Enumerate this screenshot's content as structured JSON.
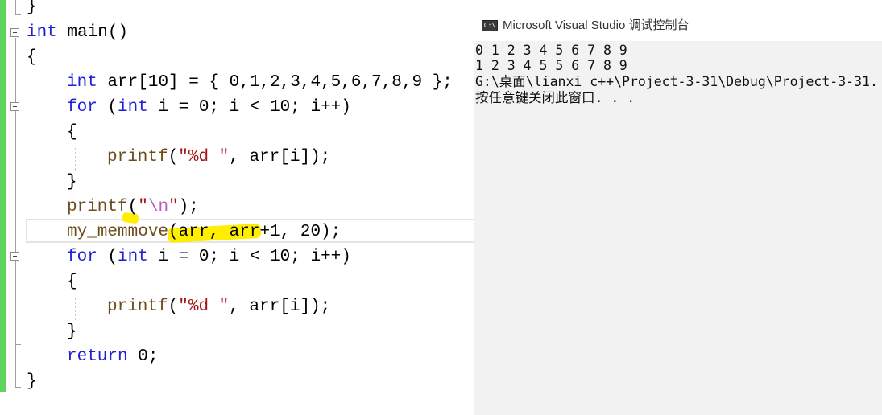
{
  "editor": {
    "closing_brace_top": "}",
    "lines": {
      "main_signature": {
        "kw": "int",
        "rest": " main()"
      },
      "open_brace": "{",
      "decl": {
        "kw": "int",
        "ident": " arr",
        "rest": "[10] = { 0,1,2,3,4,5,6,7,8,9 };"
      },
      "for1": {
        "kw": "for",
        "pre": " (",
        "kw2": "int",
        "rest": " i = 0; i < 10; i++)"
      },
      "for1_open": "{",
      "printf1": {
        "fn": "printf",
        "p1": "(",
        "str": "\"%d \"",
        "rest": ", arr[i]);"
      },
      "for1_close": "}",
      "printf_nl": {
        "fn": "printf",
        "p1": "(",
        "q1": "\"",
        "esc": "\\n",
        "q2": "\"",
        "rest": ");"
      },
      "memmove": {
        "fn": "my_memmove",
        "rest": "(arr, arr+1, 20);"
      },
      "for2": {
        "kw": "for",
        "pre": " (",
        "kw2": "int",
        "rest": " i = 0; i < 10; i++)"
      },
      "for2_open": "{",
      "printf2": {
        "fn": "printf",
        "p1": "(",
        "str": "\"%d \"",
        "rest": ", arr[i]);"
      },
      "for2_close": "}",
      "ret": {
        "kw": "return",
        "rest": " 0;"
      },
      "close_brace": "}"
    }
  },
  "console": {
    "icon_label": "C:\\",
    "title": "Microsoft Visual Studio 调试控制台",
    "output": [
      "0 1 2 3 4 5 6 7 8 9",
      "1 2 3 4 5 5 6 7 8 9",
      "G:\\桌面\\lianxi c++\\Project-3-31\\Debug\\Project-3-31.",
      "按任意键关闭此窗口. . ."
    ]
  },
  "colors": {
    "keyword": "#1f1fd6",
    "function": "#6b4c1a",
    "string": "#a31515",
    "escape": "#b85cb8",
    "change_bar": "#5ed35e",
    "highlight": "#ffee00"
  }
}
